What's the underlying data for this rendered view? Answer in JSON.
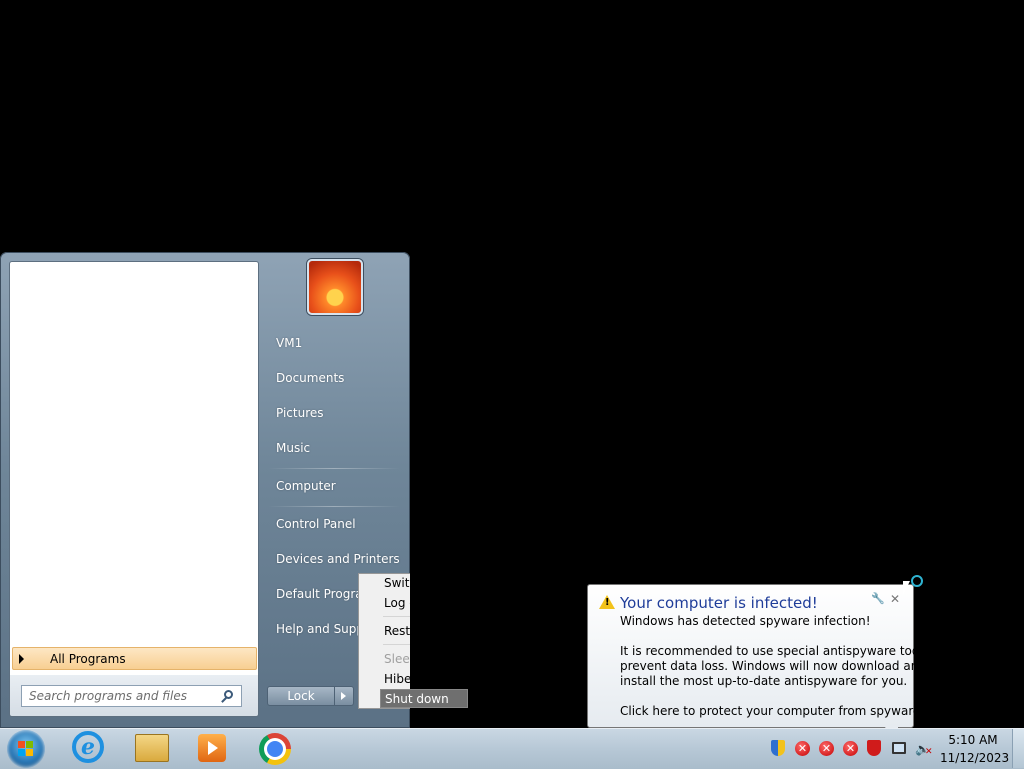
{
  "start_menu": {
    "all_programs_label": "All Programs",
    "search_placeholder": "Search programs and files",
    "right_items": [
      {
        "label": "VM1"
      },
      {
        "label": "Documents"
      },
      {
        "label": "Pictures"
      },
      {
        "label": "Music"
      },
      {
        "label": "Computer"
      },
      {
        "label": "Control Panel"
      },
      {
        "label": "Devices and Printers"
      },
      {
        "label": "Default Programs"
      },
      {
        "label": "Help and Support"
      }
    ],
    "lock_label": "Lock"
  },
  "power_menu": {
    "items": [
      {
        "label": "Switch user",
        "enabled": true
      },
      {
        "label": "Log off",
        "enabled": true
      },
      {
        "label": "Restart",
        "enabled": true
      },
      {
        "label": "Sleep",
        "enabled": false
      },
      {
        "label": "Hibernate",
        "enabled": true
      }
    ],
    "shutdown_label": "Shut down"
  },
  "balloon": {
    "title": "Your computer is infected!",
    "line1": "Windows has detected spyware infection!",
    "line2": "It is recommended to use special antispyware tools to",
    "line3": "prevent data loss. Windows will now download and",
    "line4": "install the most up-to-date antispyware for you.",
    "line5": "Click here to protect your computer from spyware!",
    "title_color": "#1f3d99"
  },
  "taskbar": {
    "pinned": [
      "internet-explorer-icon",
      "windows-explorer-icon",
      "media-player-icon",
      "chrome-icon"
    ],
    "tray_error_glyph": "✕",
    "clock_time": "5:10 AM",
    "clock_date": "11/12/2023"
  }
}
